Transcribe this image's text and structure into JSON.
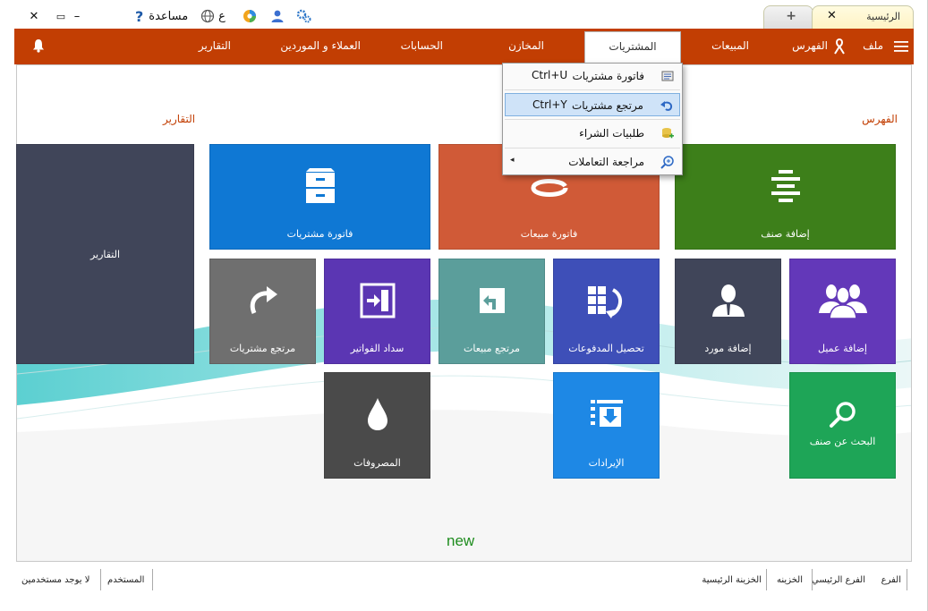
{
  "titlebar": {
    "help_label": "مساعدة",
    "help_icon": "?",
    "lang_label": "ع",
    "close_glyph": "✕",
    "minimize_glyph": "–",
    "restore_glyph": "▭"
  },
  "tabs": {
    "home_label": "الرئيسية",
    "home_close": "✕",
    "new_tab": "+"
  },
  "ribbon": {
    "file_label": "ملف",
    "catalog_label": "الفهرس",
    "sales_label": "المبيعات",
    "purchases_label": "المشتريات",
    "stores_label": "المخازن",
    "accounts_label": "الحسابات",
    "clients_label": "العملاء و الموردين",
    "reports_label": "التقارير"
  },
  "dropdown": {
    "items": [
      {
        "label": "فاتورة مشتريات",
        "shortcut": "Ctrl+U"
      },
      {
        "label": "مرتجع مشتريات",
        "shortcut": "Ctrl+Y"
      },
      {
        "label": "طلبيات الشراء",
        "shortcut": ""
      },
      {
        "label": "مراجعة التعاملات",
        "shortcut": ""
      }
    ]
  },
  "sections": {
    "catalog_title": "الفهرس",
    "reports_title": "التقارير"
  },
  "tiles": {
    "reports": "التقارير",
    "purchase_invoice": "فاتورة مشتريات",
    "sales_invoice": "فاتورة مبيعات",
    "add_item": "إضافة صنف",
    "purchase_return": "مرتجع مشتريات",
    "pay_invoices": "سداد الفواتير",
    "sales_return": "مرتجع مبيعات",
    "collect_payments": "تحصيل المدفوعات",
    "add_supplier": "إضافة مورد",
    "add_client": "إضافة عميل",
    "expenses": "المصروفات",
    "revenues": "الإيرادات",
    "search_item": "البحث عن صنف"
  },
  "colors": {
    "accent": "#c23e03",
    "tile_dark": "#404559",
    "tile_blue": "#0f78d4",
    "tile_orange": "#d05a37",
    "tile_green": "#3d7f1a",
    "tile_gray": "#6f6f6f",
    "tile_purple": "#5b36b3",
    "tile_teal": "#5b9e9b",
    "tile_indigo": "#3e4fb8",
    "tile_violet": "#6338b9",
    "tile_charcoal": "#4a4a4a",
    "tile_sky": "#1e88e5",
    "tile_emerald": "#1ea557"
  },
  "new_label": "new",
  "footer": {
    "branch_label": "الفرع",
    "branch_value": "الفرع الرئيسي",
    "safe_label": "الخزينه",
    "safe_value": "الخزينة الرئيسية",
    "user_label": "المستخدم",
    "user_value": "لا يوجد مستخدمين"
  }
}
